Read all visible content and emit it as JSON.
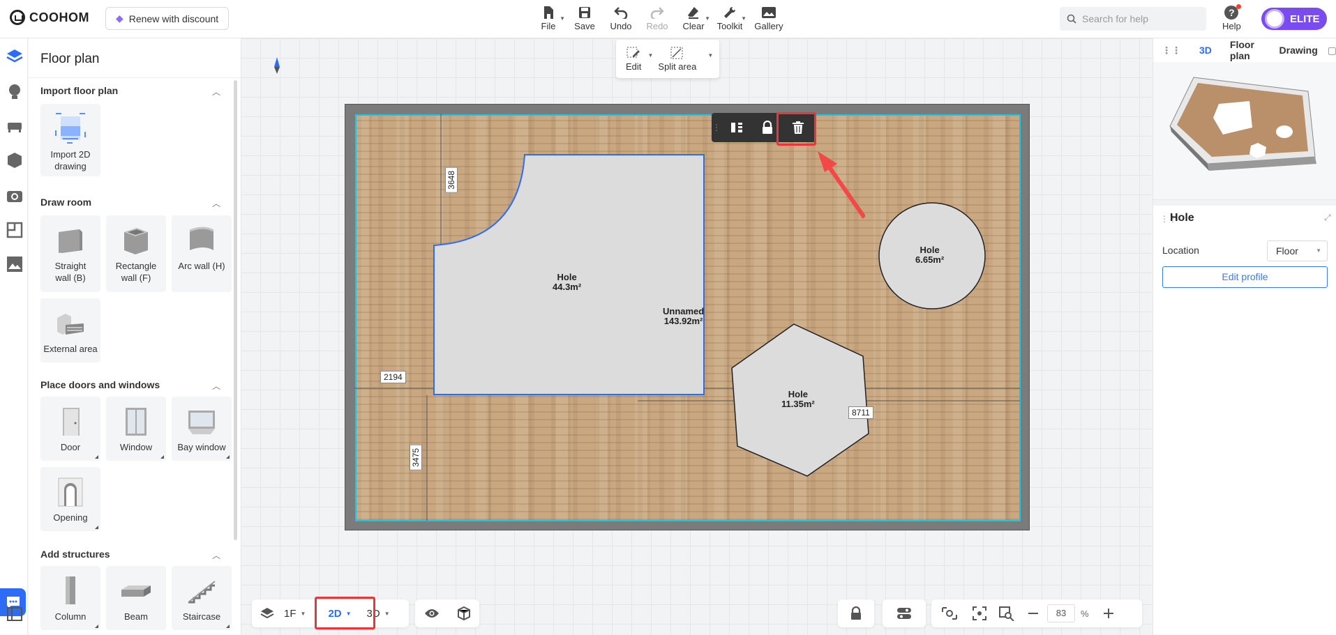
{
  "header": {
    "brand": "COOHOM",
    "renew_label": "Renew with discount",
    "tools": [
      {
        "label": "File"
      },
      {
        "label": "Save"
      },
      {
        "label": "Undo"
      },
      {
        "label": "Redo"
      },
      {
        "label": "Clear"
      },
      {
        "label": "Toolkit"
      },
      {
        "label": "Gallery"
      }
    ],
    "search_placeholder": "Search for help",
    "help_label": "Help",
    "elite_label": "ELITE"
  },
  "left_panel": {
    "title": "Floor plan",
    "sections": [
      {
        "title": "Import floor plan",
        "items": [
          "Import 2D drawing"
        ]
      },
      {
        "title": "Draw room",
        "items": [
          "Straight wall (B)",
          "Rectangle wall (F)",
          "Arc wall (H)",
          "External area"
        ]
      },
      {
        "title": "Place doors and windows",
        "items": [
          "Door",
          "Window",
          "Bay window",
          "Opening"
        ]
      },
      {
        "title": "Add structures",
        "items": [
          "Column",
          "Beam",
          "Staircase"
        ]
      }
    ]
  },
  "canvas": {
    "edit_popover": {
      "edit": "Edit",
      "split": "Split area"
    },
    "labels": {
      "hole1_name": "Hole",
      "hole1_area": "44.3m²",
      "room_name": "Unnamed",
      "room_area": "143.92m²",
      "hole2_name": "Hole",
      "hole2_area": "6.65m²",
      "hole3_name": "Hole",
      "hole3_area": "11.35m²"
    },
    "dimensions": {
      "d1": "3648",
      "d2": "2194",
      "d3": "3475",
      "d4": "8711"
    },
    "colors": {
      "selection": "#2d6df6",
      "highlight": "#e8363a",
      "wall_inner": "#18c7e6"
    }
  },
  "bottom_bar": {
    "floor": "1F",
    "view_2d": "2D",
    "view_3d": "3D",
    "zoom_value": "83",
    "zoom_unit": "%"
  },
  "right_panel": {
    "tabs": [
      "3D",
      "Floor plan",
      "Drawing"
    ],
    "prop_title": "Hole",
    "location_label": "Location",
    "location_value": "Floor",
    "edit_profile_label": "Edit profile"
  }
}
